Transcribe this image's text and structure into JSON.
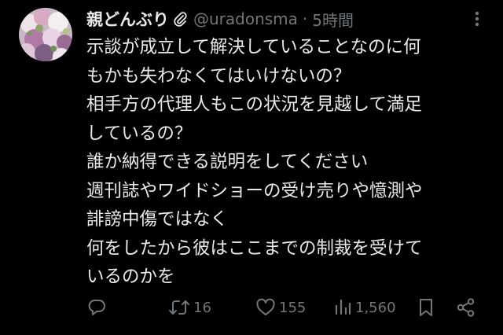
{
  "tweet": {
    "author": {
      "display_name": "親どんぶり",
      "handle": "@uradonsma",
      "badge_icon": "paperclip-icon",
      "avatar_icon": "flower-bouquet-avatar"
    },
    "separator": "·",
    "timestamp": "5時間",
    "text_lines": [
      "示談が成立して解決していることなのに何",
      "もかも失わなくてはいけないの？",
      "相手方の代理人もこの状況を見越して満足",
      "しているの？",
      "誰か納得できる説明をしてください",
      "週刊誌やワイドショーの受け売りや憶測や",
      "誹謗中傷ではなく",
      "何をしたから彼はここまでの制裁を受けて",
      "いるのかを"
    ],
    "actions": {
      "reply": {
        "icon": "reply-icon",
        "count": ""
      },
      "retweet": {
        "icon": "retweet-icon",
        "count": "16"
      },
      "like": {
        "icon": "heart-icon",
        "count": "155"
      },
      "views": {
        "icon": "views-bar-chart-icon",
        "count": "1,560"
      },
      "bookmark": {
        "icon": "bookmark-icon"
      },
      "share": {
        "icon": "share-icon"
      }
    }
  },
  "colors": {
    "background": "#000000",
    "primary_text": "#e7e9ea",
    "secondary_text": "#71767b"
  }
}
